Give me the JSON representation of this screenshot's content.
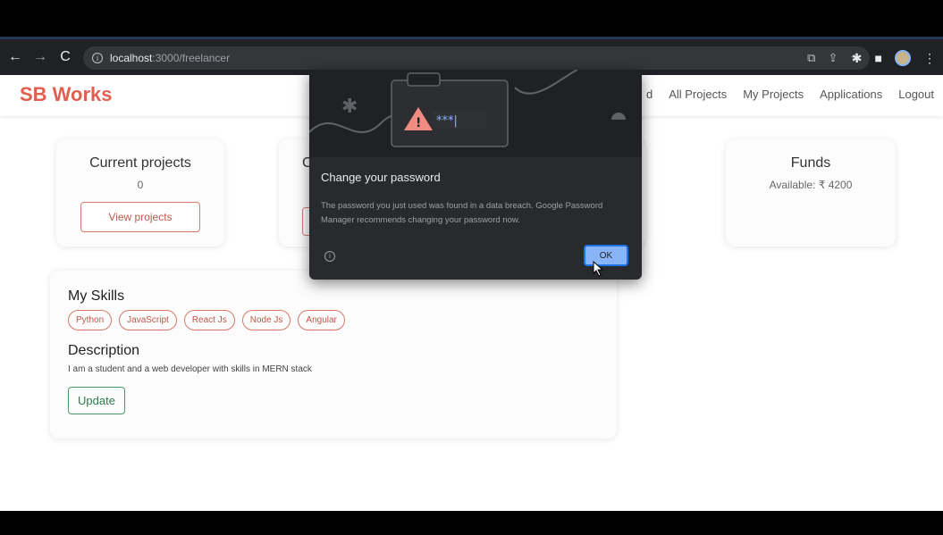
{
  "browser": {
    "url_host": "localhost",
    "url_path": ":3000/freelancer",
    "back_icon": "arrow-left-icon",
    "forward_icon": "arrow-right-icon",
    "reload_icon": "reload-icon"
  },
  "app": {
    "brand": "SB Works",
    "nav": [
      "d",
      "All Projects",
      "My Projects",
      "Applications",
      "Logout"
    ]
  },
  "cards": {
    "current_projects": {
      "title": "Current projects",
      "value": "0",
      "button": "View projects"
    },
    "funds": {
      "title": "Funds",
      "value": "Available: ₹ 4200"
    },
    "hidden_card_title_letter": "C"
  },
  "skills": {
    "title": "My Skills",
    "items": [
      "Python",
      "JavaScript",
      "React Js",
      "Node Js",
      "Angular"
    ],
    "description_title": "Description",
    "description": "I am a student and a web developer with skills in MERN stack",
    "update_button": "Update"
  },
  "dialog": {
    "title": "Change your password",
    "body": "The password you just used was found in a data breach. Google Password Manager recommends changing your password now.",
    "ok_label": "OK",
    "password_mask": "***|",
    "colors": {
      "bg": "#292a2d",
      "accent": "#8ab4f8",
      "warning": "#f28b82"
    }
  },
  "colors": {
    "brand": "#e05f4f",
    "update": "#2f7a4e"
  }
}
